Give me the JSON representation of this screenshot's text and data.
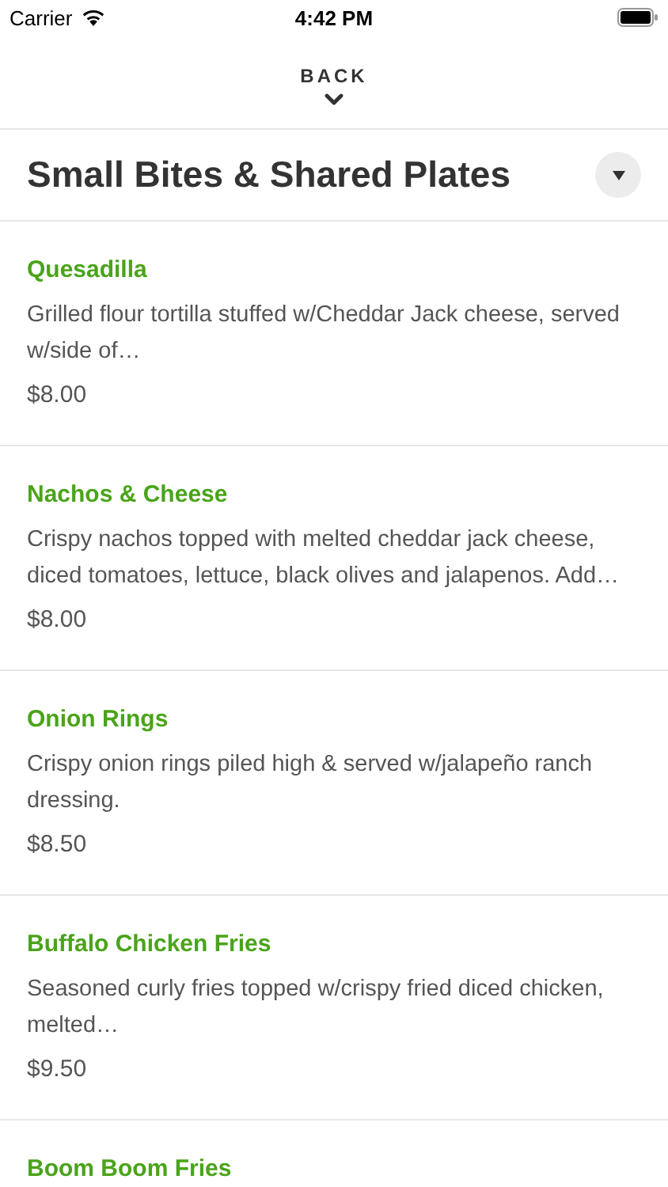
{
  "status_bar": {
    "carrier": "Carrier",
    "time": "4:42 PM"
  },
  "back": {
    "label": "BACK"
  },
  "section": {
    "title": "Small Bites & Shared Plates"
  },
  "items": [
    {
      "name": "Quesadilla",
      "description": "Grilled flour tortilla stuffed w/Cheddar Jack cheese, served w/side of…",
      "price": "$8.00"
    },
    {
      "name": "Nachos & Cheese",
      "description": "Crispy nachos topped with melted cheddar jack cheese, diced tomatoes, lettuce, black olives and jalapenos. Add…",
      "price": "$8.00"
    },
    {
      "name": "Onion Rings",
      "description": "Crispy onion rings piled high & served w/jalapeño ranch dressing.",
      "price": "$8.50"
    },
    {
      "name": "Buffalo Chicken Fries",
      "description": "Seasoned curly fries topped w/crispy fried diced chicken, melted…",
      "price": "$9.50"
    },
    {
      "name": "Boom Boom Fries"
    }
  ]
}
